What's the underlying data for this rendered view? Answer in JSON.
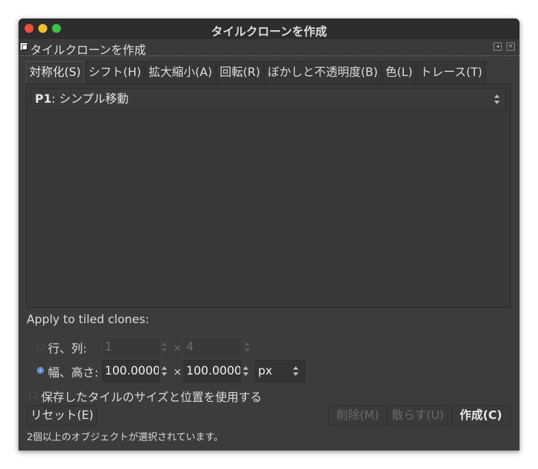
{
  "window": {
    "title": "タイルクローンを作成"
  },
  "dock": {
    "title": "タイルクローンを作成"
  },
  "tabs": [
    {
      "label": "対称化(S)",
      "active": true
    },
    {
      "label": "シフト(H)"
    },
    {
      "label": "拡大縮小(A)"
    },
    {
      "label": "回転(R)"
    },
    {
      "label": "ぼかしと不透明度(B)"
    },
    {
      "label": "色(L)"
    },
    {
      "label": "トレース(T)"
    }
  ],
  "symmetry": {
    "selected_bold": "P1",
    "selected_rest": ": シンプル移動"
  },
  "apply": {
    "heading": "Apply to tiled clones:",
    "rows_cols_label": "行、列:",
    "rows_value": "1",
    "cols_value": "4",
    "width_height_label": "幅、高さ:",
    "width_value": "100.0000",
    "height_value": "100.0000",
    "unit": "px",
    "times": "×",
    "selected_mode": "width_height"
  },
  "checkbox": {
    "label": "保存したタイルのサイズと位置を使用する",
    "checked": false
  },
  "buttons": {
    "reset": "リセット(E)",
    "remove": "削除(M)",
    "unclump": "散らす(U)",
    "create": "作成(C)"
  },
  "status": "2個以上のオブジェクトが選択されています。"
}
